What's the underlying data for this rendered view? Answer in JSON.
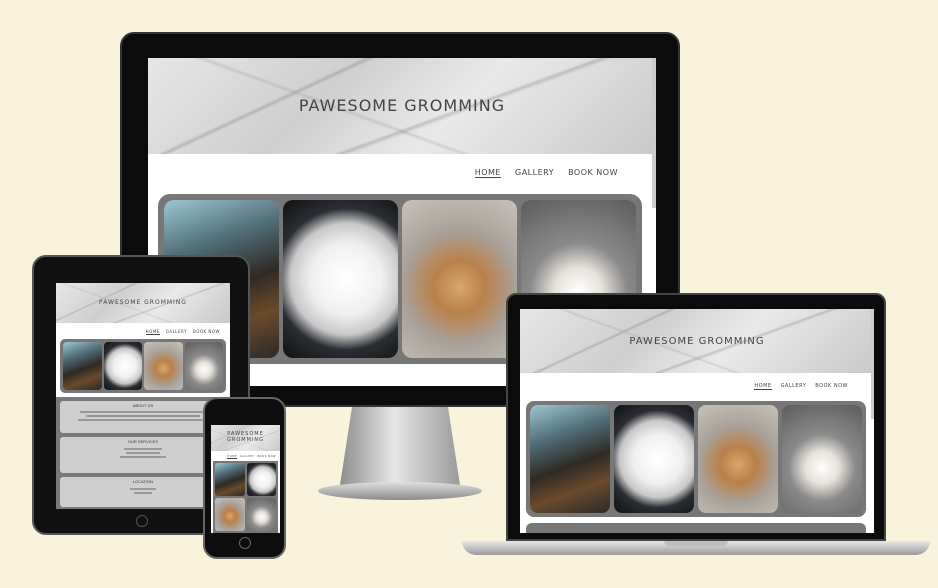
{
  "site": {
    "title": "PAWESOME GROMMING",
    "nav": [
      "HOME",
      "GALLERY",
      "BOOK NOW"
    ]
  },
  "gallery": {
    "images": [
      "grooming-yorkie-photo",
      "white-puppy-photo",
      "shih-tzu-photo",
      "white-dog-photo"
    ]
  },
  "sections": {
    "about": "ABOUT US",
    "services": "OUR SERVICES",
    "location": "LOCATION"
  },
  "colors": {
    "background": "#faf3dc",
    "device_frame": "#111111",
    "gallery_frame": "#777777"
  }
}
